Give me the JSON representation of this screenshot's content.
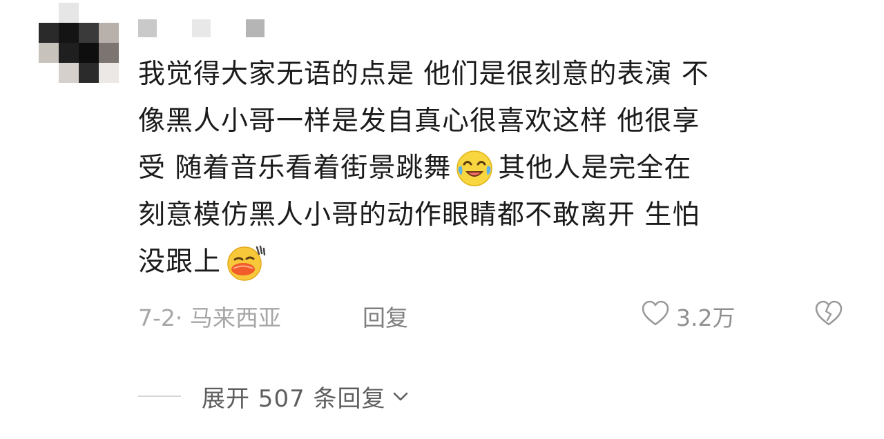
{
  "comment": {
    "lines": [
      [
        "我觉得大家无语的点是 他们是很刻意的表演 不"
      ],
      [
        "像黑人小哥一样是发自真心很喜欢这样 他很享"
      ],
      [
        "受 随着音乐看着街景跳舞",
        "其他人是完全在"
      ],
      [
        "刻意模仿黑人小哥的动作眼睛都不敢离开 生怕"
      ],
      [
        "没跟上"
      ]
    ],
    "emojis": [
      "laugh-cry-emoji-icon",
      "sweat-grin-emoji-icon"
    ]
  },
  "meta": {
    "date_location": "7-2· 马来西亚",
    "reply_label": "回复",
    "like_count": "3.2万"
  },
  "expand": {
    "label": "展开 507 条回复"
  },
  "colors": {
    "text": "#1b1b1b",
    "meta": "#9a9a9a",
    "icon": "#9a9a9a"
  }
}
